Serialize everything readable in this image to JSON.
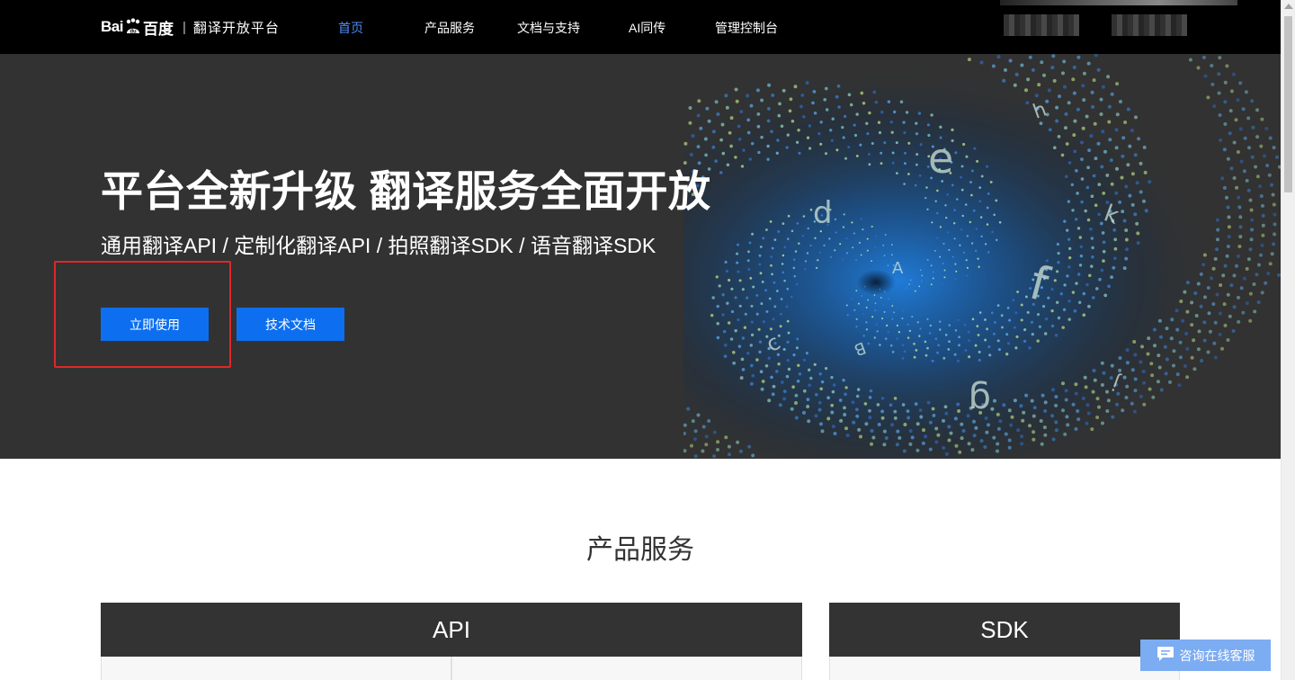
{
  "header": {
    "logo_bai": "Bai",
    "logo_du": "百度",
    "logo_separator": "|",
    "platform_name": "翻译开放平台",
    "nav": [
      {
        "label": "首页",
        "active": true
      },
      {
        "label": "产品服务",
        "active": false
      },
      {
        "label": "文档与支持",
        "active": false
      },
      {
        "label": "AI同传",
        "active": false
      },
      {
        "label": "管理控制台",
        "active": false
      }
    ]
  },
  "hero": {
    "title": "平台全新升级 翻译服务全面开放",
    "subtitle": "通用翻译API / 定制化翻译API / 拍照翻译SDK / 语音翻译SDK",
    "primary_button": "立即使用",
    "secondary_button": "技术文档",
    "art_letters": [
      "h",
      "e",
      "d",
      "k",
      "A",
      "f",
      "c",
      "B",
      "g",
      "j"
    ]
  },
  "products": {
    "title": "产品服务",
    "cards": [
      {
        "label": "API"
      },
      {
        "label": "SDK"
      }
    ]
  },
  "chat": {
    "label": "咨询在线客服",
    "icon": "chat-icon"
  },
  "colors": {
    "navbar_bg": "#000000",
    "hero_bg": "#323232",
    "primary_button": "#0d6ff0",
    "nav_active": "#4e8df5",
    "highlight": "#e0272a",
    "chat_button": "#7cacf1"
  }
}
